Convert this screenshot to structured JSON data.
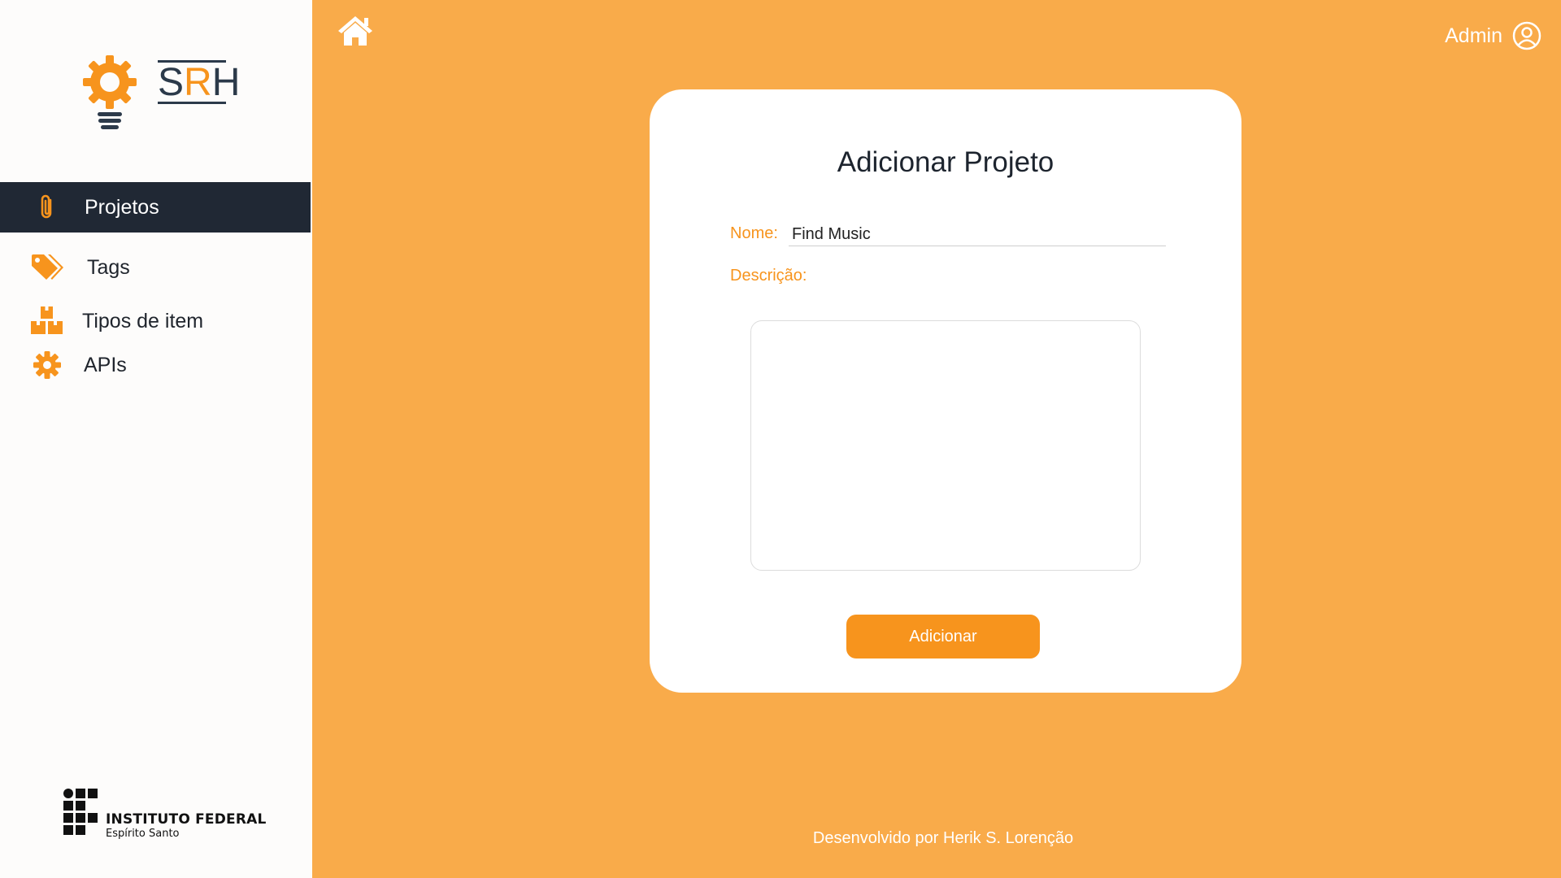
{
  "app": {
    "logo_text_prefix": "S",
    "logo_text_accent": "R",
    "logo_text_suffix": "H",
    "accent_color": "#f7941d",
    "background_color": "#f9ab4a",
    "sidebar_active_color": "#202834"
  },
  "header": {
    "home_icon": "home-icon",
    "user_name": "Admin",
    "user_icon": "user-circle-icon"
  },
  "sidebar": {
    "items": [
      {
        "label": "Projetos",
        "icon": "paperclip-icon",
        "active": true
      },
      {
        "label": "Tags",
        "icon": "tags-icon",
        "active": false
      },
      {
        "label": "Tipos de item",
        "icon": "boxes-icon",
        "active": false
      },
      {
        "label": "APIs",
        "icon": "gear-icon",
        "active": false
      }
    ],
    "institution": {
      "title": "INSTITUTO FEDERAL",
      "subtitle": "Espírito Santo"
    }
  },
  "form": {
    "title": "Adicionar Projeto",
    "name_label": "Nome:",
    "name_value": "Find Music",
    "description_label": "Descrição:",
    "description_value": "",
    "submit_label": "Adicionar"
  },
  "footer": {
    "text": "Desenvolvido por Herik S. Lorenção"
  }
}
